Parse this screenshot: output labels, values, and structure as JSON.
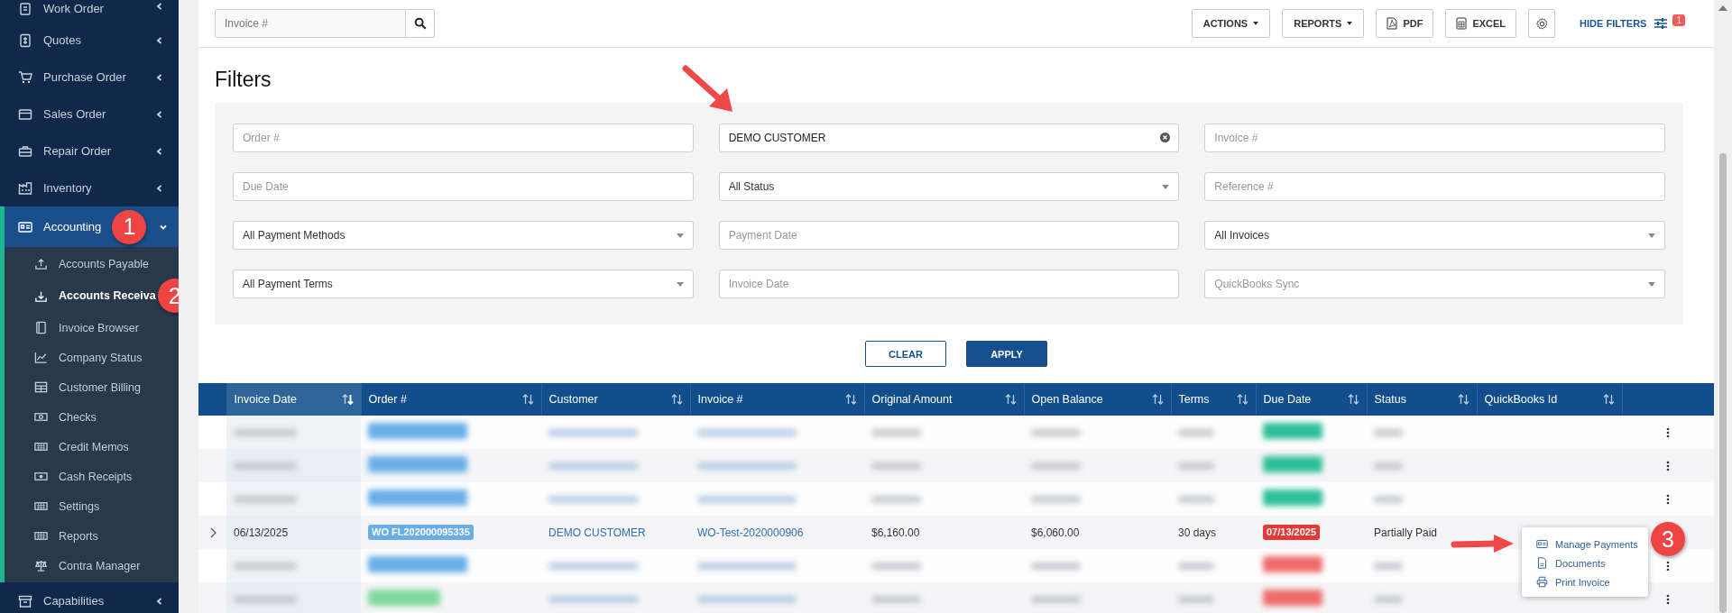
{
  "sidebar": {
    "items": [
      {
        "label": "Work Order",
        "expanded": false
      },
      {
        "label": "Quotes",
        "expanded": false
      },
      {
        "label": "Purchase Order",
        "expanded": false
      },
      {
        "label": "Sales Order",
        "expanded": false
      },
      {
        "label": "Repair Order",
        "expanded": false
      },
      {
        "label": "Inventory",
        "expanded": false
      },
      {
        "label": "Accounting",
        "expanded": true,
        "callout": "1",
        "children": [
          {
            "label": "Accounts Payable",
            "selected": false
          },
          {
            "label": "Accounts Receiva",
            "selected": true,
            "callout": "2"
          },
          {
            "label": "Invoice Browser",
            "selected": false
          },
          {
            "label": "Company Status",
            "selected": false
          },
          {
            "label": "Customer Billing",
            "selected": false
          },
          {
            "label": "Checks",
            "selected": false
          },
          {
            "label": "Credit Memos",
            "selected": false
          },
          {
            "label": "Cash Receipts",
            "selected": false
          },
          {
            "label": "Settings",
            "selected": false
          },
          {
            "label": "Reports",
            "selected": false
          },
          {
            "label": "Contra Manager",
            "selected": false
          }
        ]
      },
      {
        "label": "Capabilities",
        "expanded": false
      }
    ]
  },
  "toolbar": {
    "search": {
      "placeholder": "Invoice #"
    },
    "buttons": [
      {
        "kind": "dropdown",
        "label": "ACTIONS"
      },
      {
        "kind": "dropdown",
        "label": "REPORTS"
      },
      {
        "kind": "pdf",
        "label": "PDF"
      },
      {
        "kind": "excel",
        "label": "EXCEL"
      },
      {
        "kind": "settings"
      }
    ],
    "hide_filters": {
      "label": "HIDE FILTERS",
      "badge": "1"
    }
  },
  "filters": {
    "title": "Filters",
    "fields": [
      {
        "kind": "text",
        "placeholder": "Order #"
      },
      {
        "kind": "text",
        "value": "DEMO CUSTOMER",
        "clearable": true
      },
      {
        "kind": "text",
        "placeholder": "Invoice #"
      },
      {
        "kind": "text",
        "placeholder": "Due Date"
      },
      {
        "kind": "select",
        "value": "All Status"
      },
      {
        "kind": "text",
        "placeholder": "Reference #"
      },
      {
        "kind": "select",
        "value": "All Payment Methods"
      },
      {
        "kind": "text",
        "placeholder": "Payment Date"
      },
      {
        "kind": "select",
        "value": "All Invoices"
      },
      {
        "kind": "select",
        "value": "All Payment Terms"
      },
      {
        "kind": "text",
        "placeholder": "Invoice Date"
      },
      {
        "kind": "select",
        "placeholder": "QuickBooks Sync"
      }
    ],
    "buttons": [
      {
        "kind": "secondary",
        "label": "CLEAR"
      },
      {
        "kind": "primary",
        "label": "APPLY"
      }
    ]
  },
  "table": {
    "columns": [
      {
        "label": "Invoice Date",
        "sorted": true
      },
      {
        "label": "Order #",
        "sorted": false
      },
      {
        "label": "Customer",
        "sorted": false
      },
      {
        "label": "Invoice #",
        "sorted": false
      },
      {
        "label": "Original Amount",
        "sorted": false
      },
      {
        "label": "Open Balance",
        "sorted": false
      },
      {
        "label": "Terms",
        "sorted": false
      },
      {
        "label": "Due Date",
        "sorted": false
      },
      {
        "label": "Status",
        "sorted": false
      },
      {
        "label": "QuickBooks Id",
        "sorted": false
      }
    ],
    "rows": [
      {
        "kind": "redacted",
        "order_badge": {
          "color": "#6aaee8"
        },
        "due_badge": {
          "color": "#2fbf9a"
        }
      },
      {
        "kind": "redacted",
        "order_badge": {
          "color": "#6aaee8"
        },
        "due_badge": {
          "color": "#2fbf9a"
        }
      },
      {
        "kind": "redacted",
        "order_badge": {
          "color": "#6aaee8"
        },
        "due_badge": {
          "color": "#2fbf9a"
        }
      },
      {
        "kind": "record",
        "invoice_date": "06/13/2025",
        "order_badge": {
          "label": "WO FL202000095335",
          "color": "#6aaee8"
        },
        "customer": "DEMO CUSTOMER",
        "invoice": "WO-Test-2020000906",
        "original_amount": "$6,160.00",
        "open_balance": "$6,060.00",
        "terms": "30 days",
        "due_badge": {
          "label": "07/13/2025",
          "color": "#e53935"
        },
        "status": "Partially Paid"
      },
      {
        "kind": "redacted",
        "order_badge": {
          "color": "#6aaee8"
        },
        "due_badge": {
          "color": "#ef6b6b"
        }
      },
      {
        "kind": "redacted",
        "order_badge": {
          "color": "#7fd99a"
        },
        "due_badge": {
          "color": "#ef6b6b"
        }
      }
    ],
    "row_menu": {
      "callout": "3",
      "items": [
        {
          "label": "Manage Payments"
        },
        {
          "label": "Documents"
        },
        {
          "label": "Print Invoice"
        }
      ]
    }
  }
}
